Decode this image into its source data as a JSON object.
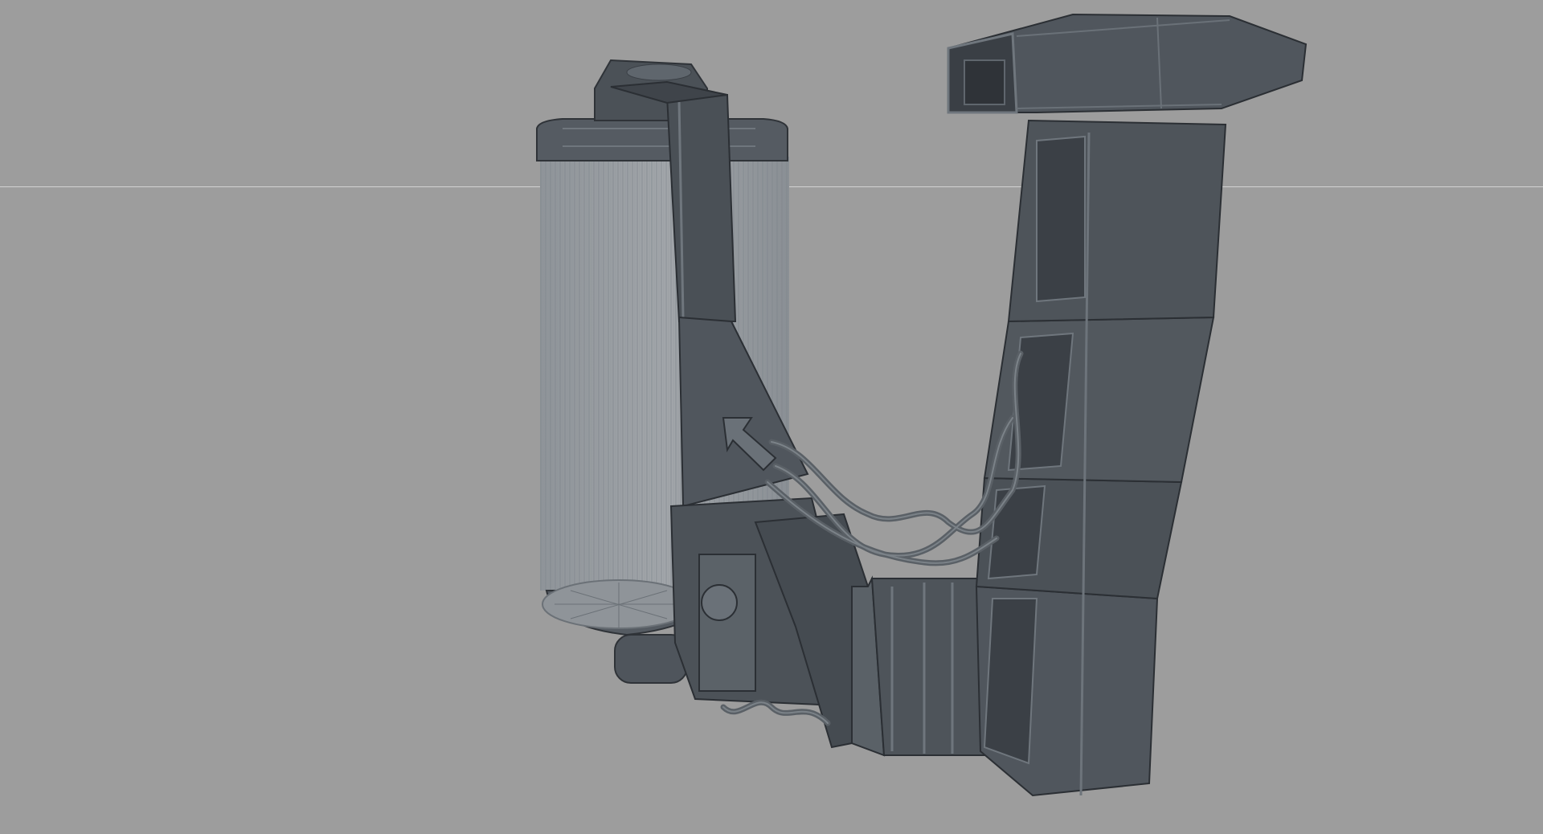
{
  "viewport": {
    "background": "#9d9d9d",
    "horizon_color": "#d2d2d2",
    "display_mode": "shaded-wireframe"
  },
  "model": {
    "base_color": "#4f555c",
    "dark_color": "#3b4046",
    "light_color": "#6f767d",
    "wire_color": "#9aa0a6",
    "parts": [
      "canister",
      "back-frame",
      "handle-arm",
      "hoses",
      "nozzle-head"
    ]
  }
}
